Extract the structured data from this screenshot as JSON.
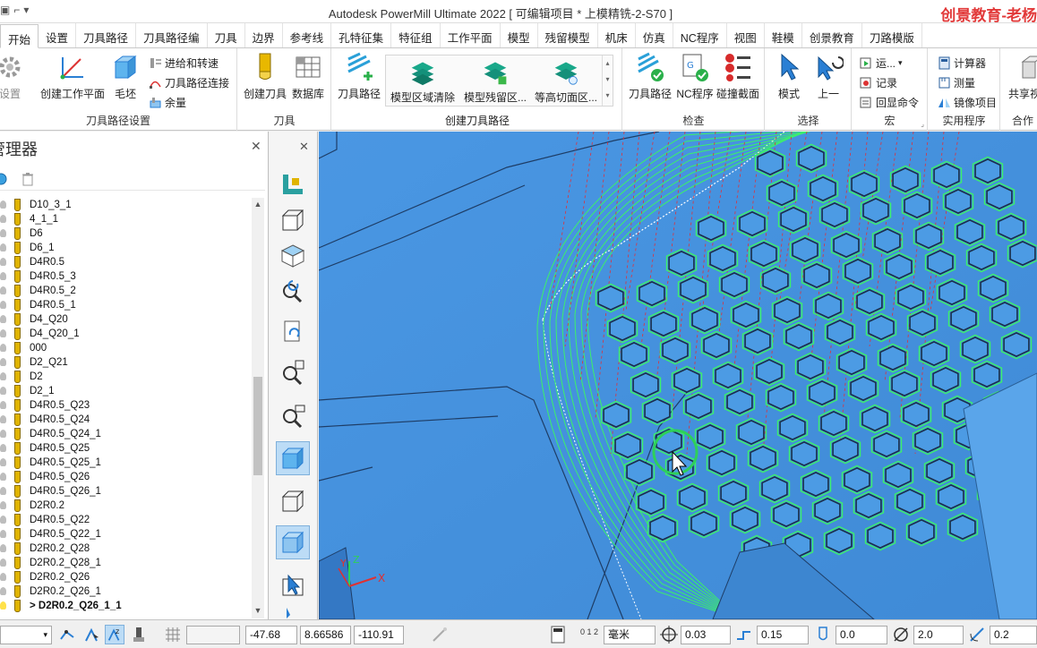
{
  "window": {
    "title": "Autodesk PowerMill Ultimate 2022   [ 可编辑项目 * 上模精铣-2-S70 ]",
    "brand_watermark": "创景教育-老杨"
  },
  "tabs": [
    "开始",
    "设置",
    "刀具路径",
    "刀具路径编",
    "刀具",
    "边界",
    "参考线",
    "孔特征集",
    "特征组",
    "工作平面",
    "模型",
    "残留模型",
    "机床",
    "仿真",
    "NC程序",
    "视图",
    "鞋模",
    "创景教育",
    "刀路模版"
  ],
  "ribbon": {
    "groups": {
      "toolpath_setup": {
        "label": "刀具路径设置",
        "setup_btn": "设置",
        "create_workplane": "创建工作平面",
        "block": "毛坯",
        "leads_links": "进给和转速",
        "toolpath_connections": "刀具路径连接",
        "allowance": "余量"
      },
      "tools": {
        "label": "刀具",
        "create_tool": "创建刀具",
        "database": "数据库"
      },
      "create_toolpath": {
        "label": "创建刀具路径",
        "toolpath": "刀具路径",
        "model_area_clearance": "模型区域清除",
        "model_rest_area": "模型残留区...",
        "constant_z": "等高切面区..."
      },
      "verify": {
        "label": "检查",
        "toolpath": "刀具路径",
        "nc_program": "NC程序",
        "collision": "碰撞截面"
      },
      "select": {
        "label": "选择",
        "mode": "模式",
        "previous": "上一"
      },
      "macro": {
        "label": "宏",
        "run": "运...",
        "record": "记录",
        "echo": "回显命令"
      },
      "utilities": {
        "label": "实用程序",
        "calculator": "计算器",
        "measure": "测量",
        "mirror": "镜像项目"
      },
      "collab": {
        "label": "合作",
        "share": "共享视"
      }
    }
  },
  "explorer": {
    "title": "管理器",
    "items": [
      "D10_3_1",
      "4_1_1",
      "D6",
      "D6_1",
      "D4R0.5",
      "D4R0.5_3",
      "D4R0.5_2",
      "D4R0.5_1",
      "D4_Q20",
      "D4_Q20_1",
      "000",
      "D2_Q21",
      "D2",
      "D2_1",
      "D4R0.5_Q23",
      "D4R0.5_Q24",
      "D4R0.5_Q24_1",
      "D4R0.5_Q25",
      "D4R0.5_Q25_1",
      "D4R0.5_Q26",
      "D4R0.5_Q26_1",
      "D2R0.2",
      "D4R0.5_Q22",
      "D4R0.5_Q22_1",
      "D2R0.2_Q28",
      "D2R0.2_Q28_1",
      "D2R0.2_Q26",
      "D2R0.2_Q26_1"
    ],
    "active_item": "> D2R0.2_Q26_1_1"
  },
  "status": {
    "x": "-47.68",
    "y": "8.66586",
    "z": "-110.91",
    "units": "毫米",
    "tolerance": "0.03",
    "stepover": "0.15",
    "thickness": "0.0",
    "diameter": "2.0",
    "corner": "0.2",
    "ratio_label": "0 1 2"
  },
  "triad": {
    "x": "X",
    "y": "Y",
    "z": "Z"
  },
  "colors": {
    "viewport_bg": "#4d9be6",
    "toolpath_green": "#3cf06a",
    "accent": "#2a7fd4"
  }
}
